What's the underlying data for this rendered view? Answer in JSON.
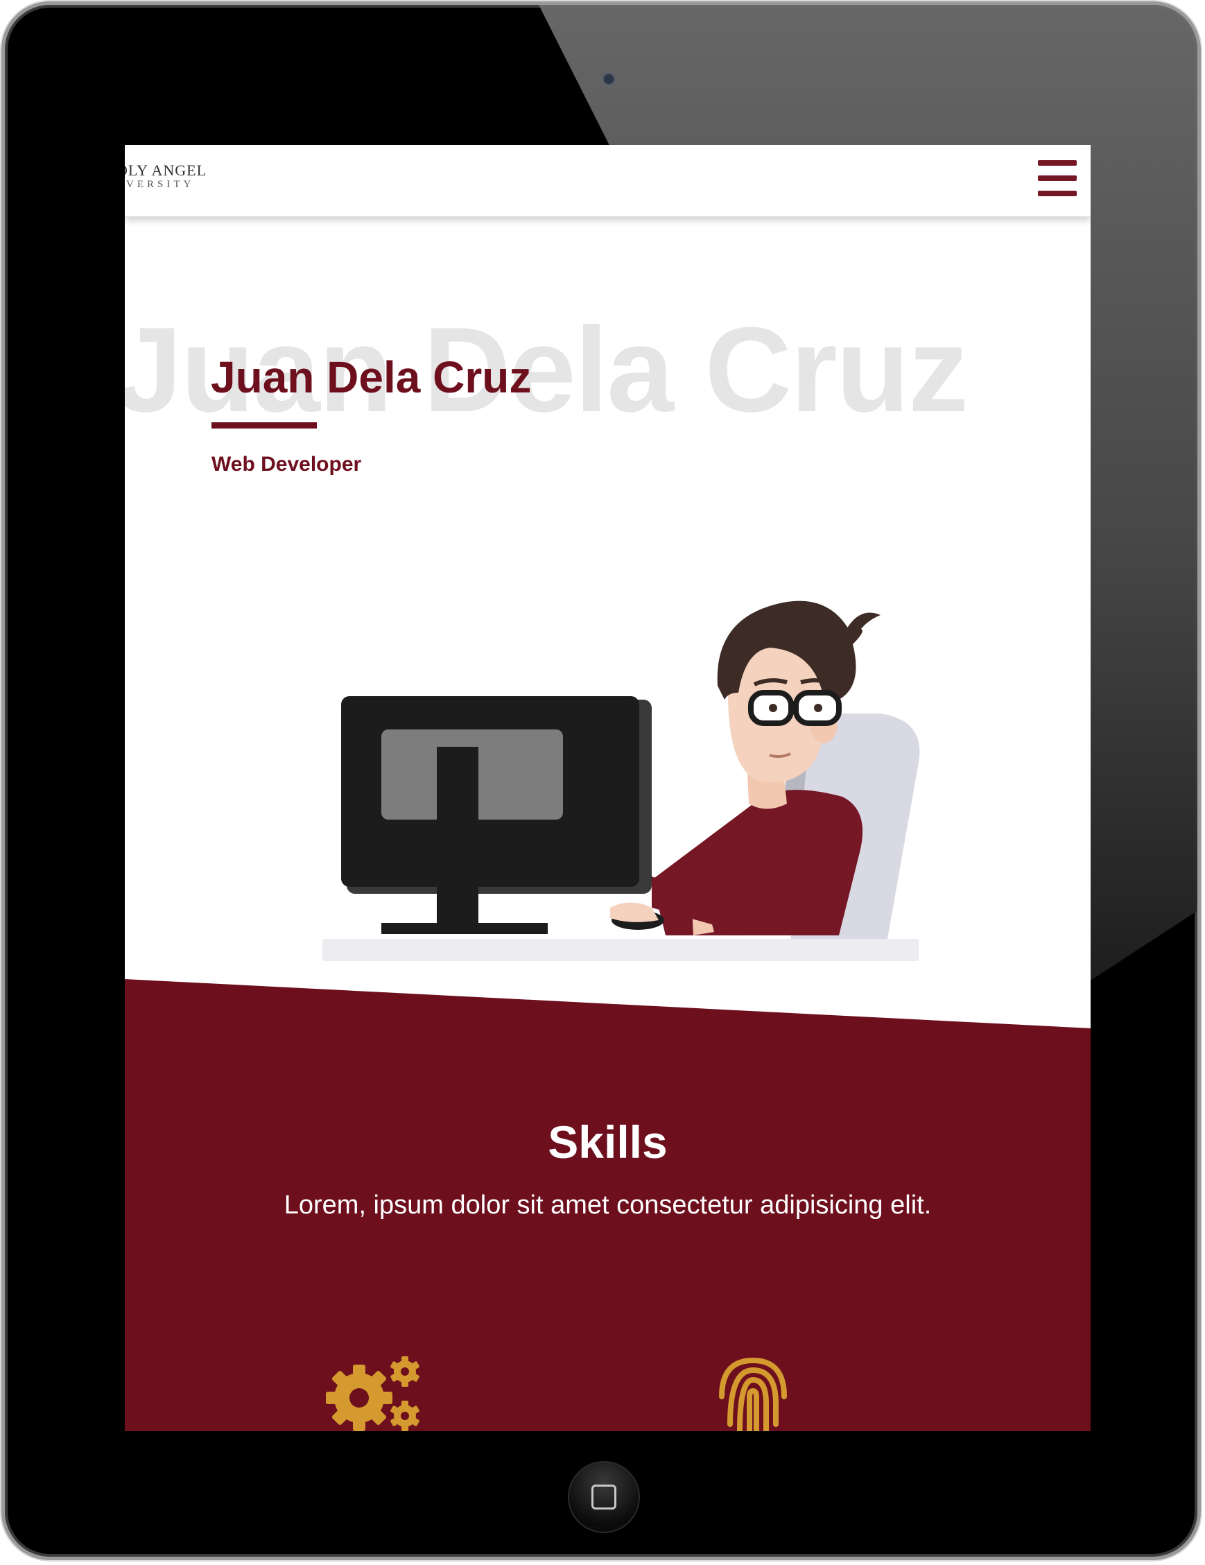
{
  "header": {
    "logo_line1": "OLY ANGEL",
    "logo_line2": "IVERSITY",
    "menu_icon": "hamburger-menu-icon"
  },
  "hero": {
    "background_name": "Juan Dela Cruz",
    "name": "Juan Dela Cruz",
    "role": "Web Developer",
    "illustration": "developer-at-computer-illustration"
  },
  "skills": {
    "title": "Skills",
    "description": "Lorem, ipsum dolor sit amet consectetur adipisicing elit.",
    "icons": [
      "gears-icon",
      "fingerprint-icon"
    ]
  },
  "colors": {
    "maroon": "#6e0f1e",
    "gold": "#d49a2f",
    "background_text": "#e5e5e5"
  }
}
